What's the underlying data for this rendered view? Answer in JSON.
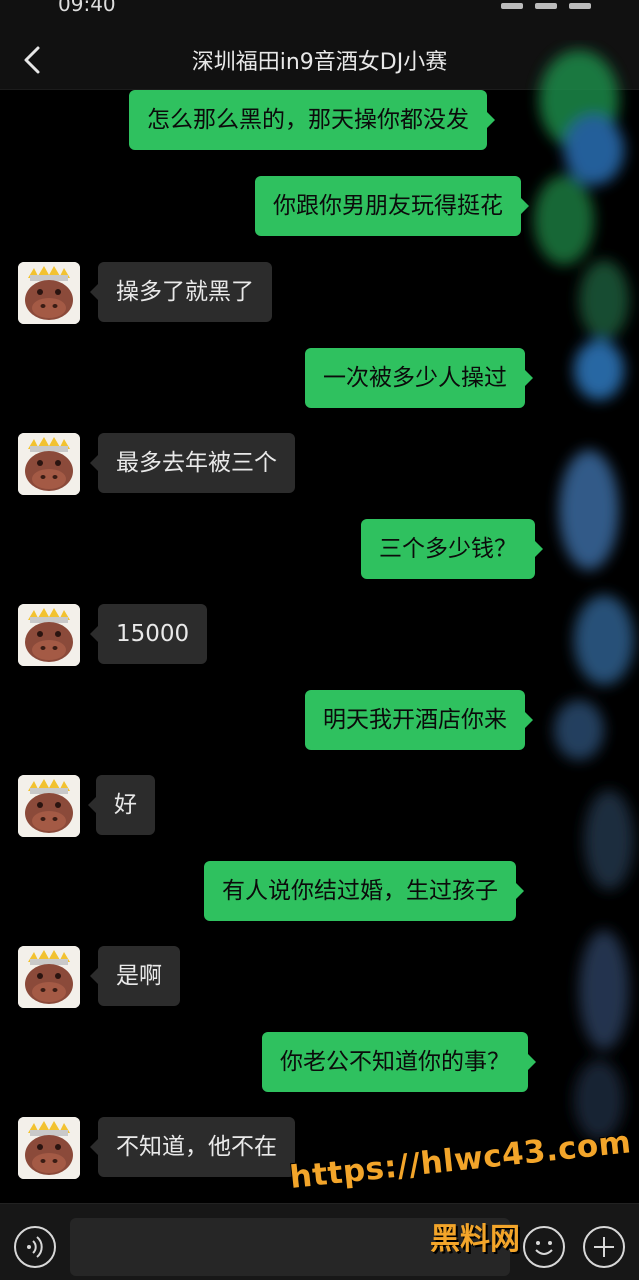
{
  "status_bar": {
    "time": "09:40"
  },
  "header": {
    "title": "深圳福田in9音酒女DJ小赛",
    "back_icon": "chevron-left-icon"
  },
  "messages": [
    {
      "side": "right",
      "text": "怎么那么黑的，那天操你都没发"
    },
    {
      "side": "right",
      "text": "你跟你男朋友玩得挺花"
    },
    {
      "side": "left",
      "text": "操多了就黑了"
    },
    {
      "side": "right",
      "text": "一次被多少人操过"
    },
    {
      "side": "left",
      "text": "最多去年被三个"
    },
    {
      "side": "right",
      "text": "三个多少钱？"
    },
    {
      "side": "left",
      "text": "15000"
    },
    {
      "side": "right",
      "text": "明天我开酒店你来"
    },
    {
      "side": "left",
      "text": "好"
    },
    {
      "side": "right",
      "text": "有人说你结过婚，生过孩子"
    },
    {
      "side": "left",
      "text": "是啊"
    },
    {
      "side": "right",
      "text": "你老公不知道你的事？"
    },
    {
      "side": "left",
      "text": "不知道，他不在"
    }
  ],
  "toolbar": {
    "voice_icon": "voice-icon",
    "input_value": "",
    "emoji_icon": "emoji-icon",
    "plus_icon": "plus-icon"
  },
  "watermark": {
    "url": "https://hlwc43.com",
    "text": "黑料网"
  },
  "colors": {
    "background": "#000000",
    "bubble_self": "#2fc15f",
    "bubble_other": "#2c2c2c",
    "watermark": "#f3a52a"
  }
}
